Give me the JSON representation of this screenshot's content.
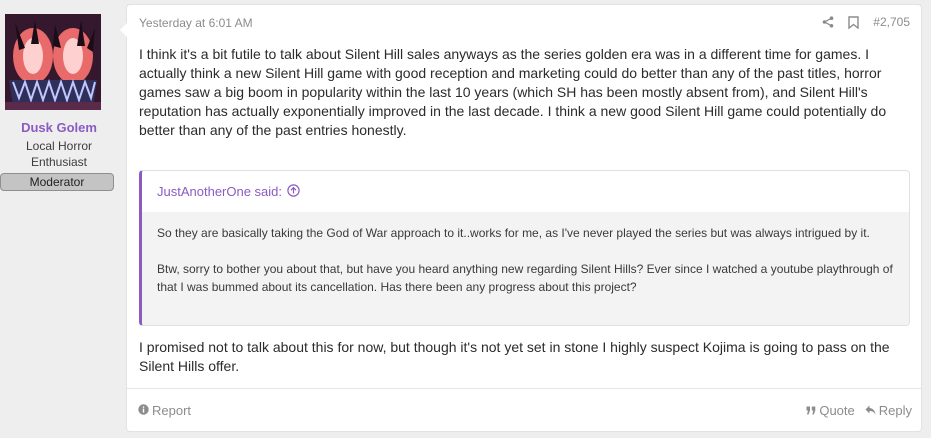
{
  "user": {
    "name": "Dusk Golem",
    "title": "Local Horror Enthusiast",
    "banner": "Moderator"
  },
  "post": {
    "timestamp": "Yesterday at 6:01 AM",
    "post_number": "#2,705",
    "paragraph1": "I think it's a bit futile to talk about Silent Hill sales anyways as the series golden era was in a different time for games. I actually think a new Silent Hill game with good reception and marketing could do better than any of the past titles, horror games saw a big boom in popularity within the last 10 years (which SH has been mostly absent from), and Silent Hill's reputation has actually exponentially improved in the last decade. I think a new good Silent Hill game could potentially do better than any of the past entries honestly.",
    "quote": {
      "attribution": "JustAnotherOne said:",
      "paragraph1": "So they are basically taking the God of War approach to it..works for me, as I've never played the series but was always intrigued by it.",
      "paragraph2": "Btw, sorry to bother you about that, but have you heard anything new regarding Silent Hills? Ever since I watched a youtube playthrough of that I was bummed about its cancellation. Has there been any progress about this project?"
    },
    "paragraph2": "I promised not to talk about this for now, but though it's not yet set in stone I highly suspect Kojima is going to pass on the Silent Hills offer."
  },
  "footer": {
    "report_label": "Report",
    "quote_label": "Quote",
    "reply_label": "Reply"
  },
  "icons": {
    "share": "share-icon",
    "bookmark": "bookmark-icon",
    "jump": "arrow-up-circle-icon",
    "report": "info-circle-icon",
    "quote": "quote-icon",
    "reply": "reply-icon"
  },
  "colors": {
    "accent": "#8a5cc2",
    "page_bg": "#eeeeee",
    "card_bg": "#ffffff",
    "quote_bg": "#f3f3f3",
    "muted": "#8c8c8c"
  }
}
